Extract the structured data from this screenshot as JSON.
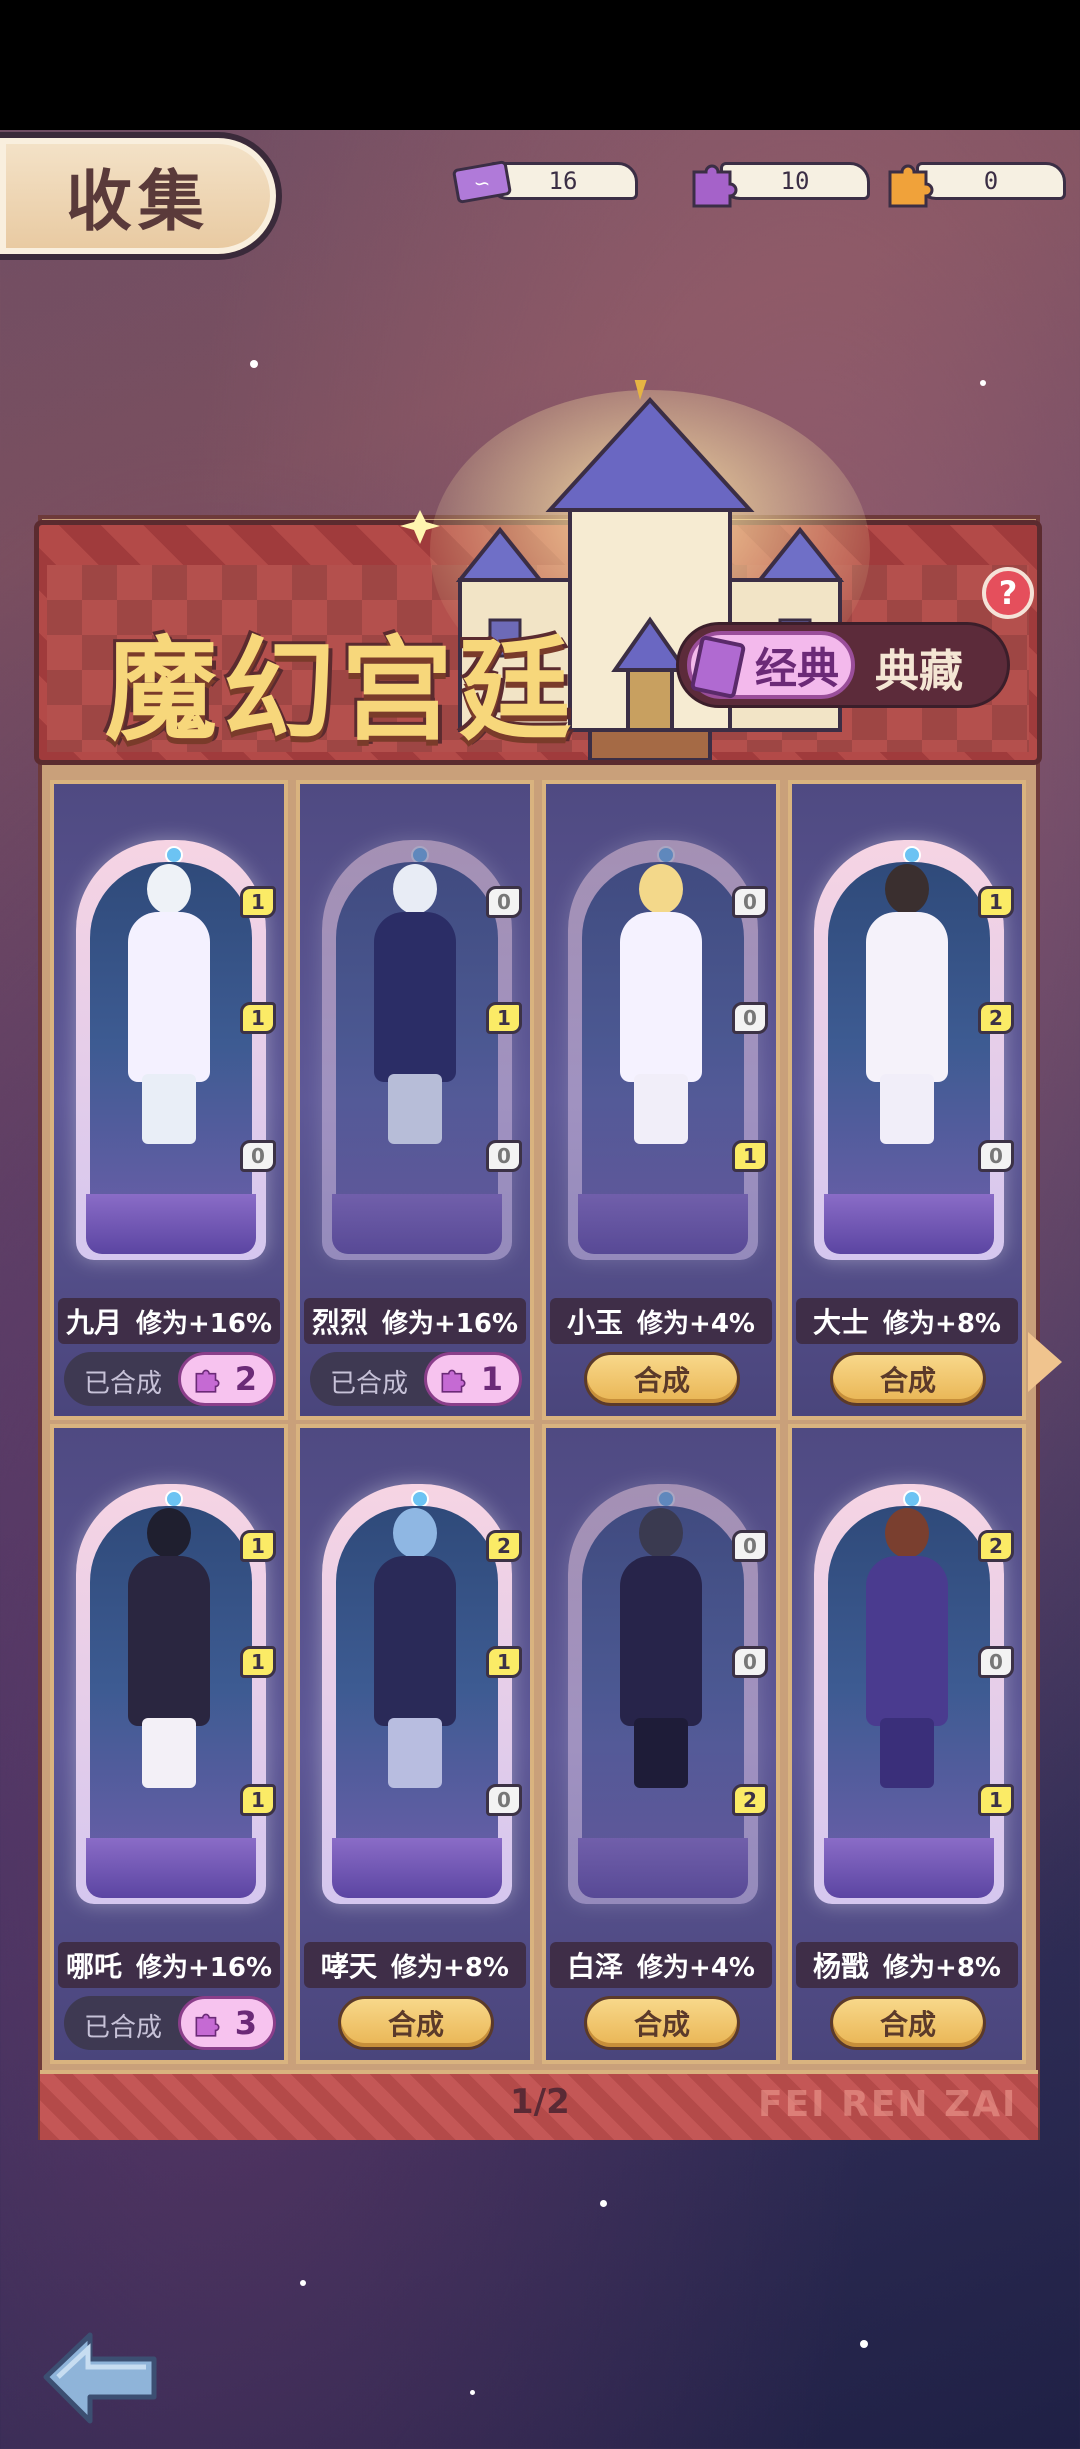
{
  "header": {
    "tab_label": "收集",
    "resources": [
      {
        "icon": "ticket-icon",
        "value": "16",
        "color": "#b07ad9"
      },
      {
        "icon": "purple-puzzle-icon",
        "value": "10",
        "color": "#a562c9"
      },
      {
        "icon": "orange-puzzle-icon",
        "value": "0",
        "color": "#f0a23a"
      }
    ]
  },
  "banner": {
    "title": "魔幻宫廷",
    "toggle": {
      "active": "经典",
      "inactive": "典藏"
    },
    "help": "?"
  },
  "cards": [
    {
      "name": "九月",
      "bonus": "修为+16%",
      "pieces": [
        "1",
        "1",
        "0"
      ],
      "state": "made",
      "made_label": "已合成",
      "made_count": "2",
      "colors": {
        "head": "#eef2f7",
        "body": "#f4f1ff",
        "legs": "#e9eef7"
      }
    },
    {
      "name": "烈烈",
      "bonus": "修为+16%",
      "pieces": [
        "0",
        "1",
        "0"
      ],
      "state": "made",
      "made_label": "已合成",
      "made_count": "1",
      "colors": {
        "head": "#e8ecf5",
        "body": "#2b2d66",
        "legs": "#b7bdd8"
      }
    },
    {
      "name": "小玉",
      "bonus": "修为+4%",
      "pieces": [
        "0",
        "0",
        "1"
      ],
      "state": "button",
      "button_label": "合成",
      "colors": {
        "head": "#f3d88a",
        "body": "#f5f2ff",
        "legs": "#f1eef9"
      }
    },
    {
      "name": "大士",
      "bonus": "修为+8%",
      "pieces": [
        "1",
        "2",
        "0"
      ],
      "state": "button",
      "button_label": "合成",
      "colors": {
        "head": "#3a2f2f",
        "body": "#f5f2fa",
        "legs": "#f1eef9"
      }
    },
    {
      "name": "哪吒",
      "bonus": "修为+16%",
      "pieces": [
        "1",
        "1",
        "1"
      ],
      "state": "made",
      "made_label": "已合成",
      "made_count": "3",
      "colors": {
        "head": "#1f1f2f",
        "body": "#2a2640",
        "legs": "#f3f0f7"
      }
    },
    {
      "name": "哮天",
      "bonus": "修为+8%",
      "pieces": [
        "2",
        "1",
        "0"
      ],
      "state": "button",
      "button_label": "合成",
      "colors": {
        "head": "#8fb7e3",
        "body": "#2a2a58",
        "legs": "#b8bde0"
      }
    },
    {
      "name": "白泽",
      "bonus": "修为+4%",
      "pieces": [
        "0",
        "0",
        "2"
      ],
      "state": "button",
      "button_label": "合成",
      "colors": {
        "head": "#3a3a50",
        "body": "#27244a",
        "legs": "#1e1c38"
      }
    },
    {
      "name": "杨戬",
      "bonus": "修为+8%",
      "pieces": [
        "2",
        "0",
        "1"
      ],
      "state": "button",
      "button_label": "合成",
      "colors": {
        "head": "#7a3f2f",
        "body": "#4a3b8f",
        "legs": "#3a2f7a"
      }
    }
  ],
  "footer": {
    "page": "1/2",
    "watermark": "FEI REN ZAI"
  }
}
